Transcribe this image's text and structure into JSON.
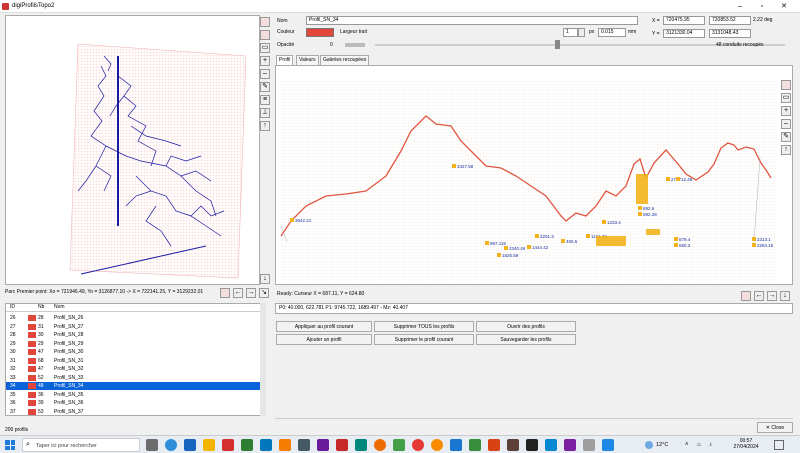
{
  "window": {
    "title": "digiProfilsTopo2"
  },
  "map": {
    "coord_text": "Parc Premier point: Xo = 721946.49, Yo = 3126877.10 -> X = 722141.25, Y = 3129232.01"
  },
  "form": {
    "nom_label": "Nom",
    "nom_value": "Profil_SN_34",
    "couleur_label": "Couleur",
    "largeur_label": "Largeur trait",
    "largeur_value": "1",
    "px_label": "px",
    "mm_value": "0.015",
    "mm_label": "mm",
    "opacite_label": "Opacité",
    "opacite_value": "0",
    "x_label": "X =",
    "x1": "720475.95",
    "x2": "720853.52",
    "deg": "2.22 deg",
    "y_label": "Y =",
    "y1": "3121330.04",
    "y2": "3131048.43",
    "conduits": "48 conduits recoupés"
  },
  "tabs": [
    "Profil",
    "Valeurs",
    "Galeries recoupées"
  ],
  "status": {
    "ready": "Ready: Curseur X = 687.11, Y = 624.80",
    "p_line": "P0: 40.000, 622.781 P1: 9745.722, 1689.497 - Mz: 40.407"
  },
  "buttons": {
    "appliquer": "Appliquer au profil courant",
    "supprimer_tous": "Supprimer TOUS les profils",
    "ouvrir": "Ouvrir des profils",
    "ajouter": "Ajouter un profil",
    "supprimer_courant": "Supprimer le profil courant",
    "sauvegarder": "Sauvegarder les profils"
  },
  "list": {
    "headers": {
      "id": "ID",
      "nb": "Nb",
      "nom": "Nom"
    },
    "rows": [
      {
        "id": "26",
        "nb": "28",
        "nom": "Profil_SN_26"
      },
      {
        "id": "27",
        "nb": "31",
        "nom": "Profil_SN_27"
      },
      {
        "id": "28",
        "nb": "30",
        "nom": "Profil_SN_28"
      },
      {
        "id": "29",
        "nb": "29",
        "nom": "Profil_SN_29"
      },
      {
        "id": "30",
        "nb": "47",
        "nom": "Profil_SN_30"
      },
      {
        "id": "31",
        "nb": "68",
        "nom": "Profil_SN_31"
      },
      {
        "id": "32",
        "nb": "47",
        "nom": "Profil_SN_32"
      },
      {
        "id": "33",
        "nb": "52",
        "nom": "Profil_SN_33"
      },
      {
        "id": "34",
        "nb": "48",
        "nom": "Profil_SN_34"
      },
      {
        "id": "35",
        "nb": "36",
        "nom": "Profil_SN_35"
      },
      {
        "id": "36",
        "nb": "39",
        "nom": "Profil_SN_36"
      },
      {
        "id": "37",
        "nb": "53",
        "nom": "Profil_SN_37"
      }
    ],
    "selected_index": 8,
    "count": "200 profils"
  },
  "chart_labels": {
    "a": "3642.21",
    "b": "3427.58",
    "c": "997.119",
    "d": "2340.46",
    "e": "1444.42",
    "f": "2201.3",
    "g": "465.5",
    "h": "1825.59",
    "i": "1151.22",
    "j": "1233.4",
    "k": "692.6",
    "l": "692.28",
    "m": "679.4",
    "n": "680.2",
    "o": "2313.1",
    "p": "2284.16",
    "q": "2717",
    "r": "12.49"
  },
  "taskbar": {
    "search": "Taper ici pour rechercher",
    "temp": "12°C",
    "time": "00:57",
    "date": "27/04/2024"
  },
  "colors": {
    "swatch": "#e2463a",
    "profile_line": "#e05540",
    "selection": "#0a63d8",
    "caves": "#1a1aa0"
  }
}
